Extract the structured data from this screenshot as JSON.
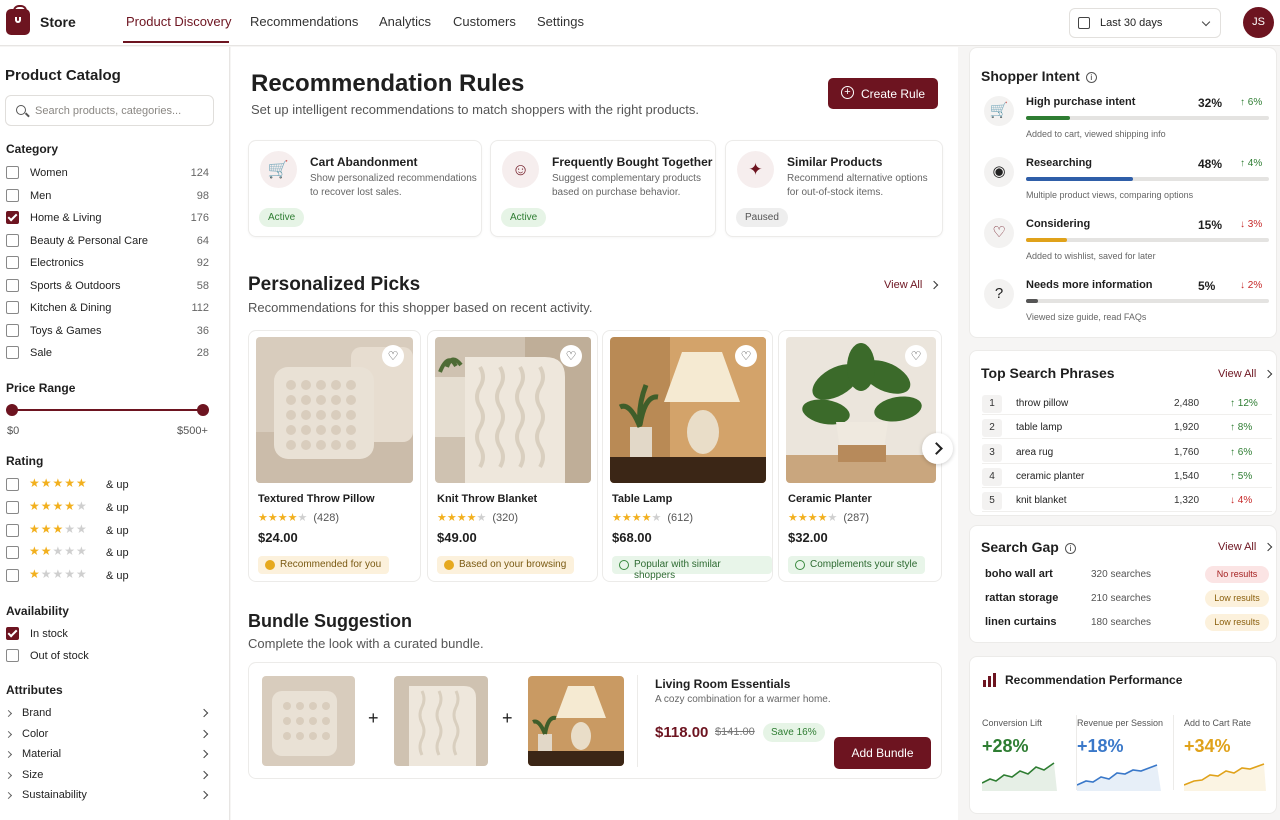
{
  "topbar": {
    "brand": "Store",
    "nav": [
      "Product Discovery",
      "Recommendations",
      "Analytics",
      "Customers",
      "Settings"
    ],
    "date_range": "Last 30 days",
    "avatar_initials": "JS"
  },
  "sidebar": {
    "title": "Product Catalog",
    "search_placeholder": "Search products, categories...",
    "category_heading": "Category",
    "categories": [
      {
        "label": "Women",
        "count": "124",
        "checked": false
      },
      {
        "label": "Men",
        "count": "98",
        "checked": false
      },
      {
        "label": "Home & Living",
        "count": "176",
        "checked": true
      },
      {
        "label": "Beauty & Personal Care",
        "count": "64",
        "checked": false
      },
      {
        "label": "Electronics",
        "count": "92",
        "checked": false
      },
      {
        "label": "Sports & Outdoors",
        "count": "58",
        "checked": false
      },
      {
        "label": "Kitchen & Dining",
        "count": "112",
        "checked": false
      },
      {
        "label": "Toys & Games",
        "count": "36",
        "checked": false
      },
      {
        "label": "Sale",
        "count": "28",
        "checked": false
      }
    ],
    "price_heading": "Price Range",
    "price_min": "$0",
    "price_max": "$500+",
    "rating_heading": "Rating",
    "rating_suffix": "& up",
    "ratings": [
      5,
      4,
      3,
      2,
      1
    ],
    "availability_heading": "Availability",
    "availability": [
      {
        "label": "In stock",
        "checked": true
      },
      {
        "label": "Out of stock",
        "checked": false
      }
    ],
    "attributes_heading": "Attributes",
    "attributes": [
      "Brand",
      "Color",
      "Material",
      "Size",
      "Sustainability"
    ]
  },
  "main": {
    "title": "Recommendation Rules",
    "subtitle": "Set up intelligent recommendations to match shoppers with the right products.",
    "create_button": "Create Rule",
    "rules": [
      {
        "title": "Cart Abandonment",
        "desc": "Show personalized recommendations to recover lost sales.",
        "status": "Active",
        "icon": "cart-icon"
      },
      {
        "title": "Frequently Bought Together",
        "desc": "Suggest complementary products based on purchase behavior.",
        "status": "Active",
        "icon": "people-icon"
      },
      {
        "title": "Similar Products",
        "desc": "Recommend alternative options for out-of-stock items.",
        "status": "Paused",
        "icon": "sparkle-icon"
      }
    ],
    "picks_title": "Personalized Picks",
    "picks_subtitle": "Recommendations for this shopper based on recent activity.",
    "view_all": "View All",
    "products": [
      {
        "name": "Textured Throw Pillow",
        "rating": 4.5,
        "reviews": "(428)",
        "price": "$24.00",
        "tag": "Recommended for you",
        "tag_style": "yellow"
      },
      {
        "name": "Knit Throw Blanket",
        "rating": 4.5,
        "reviews": "(320)",
        "price": "$49.00",
        "tag": "Based on your browsing",
        "tag_style": "yellow"
      },
      {
        "name": "Table Lamp",
        "rating": 4.5,
        "reviews": "(612)",
        "price": "$68.00",
        "tag": "Popular with similar shoppers",
        "tag_style": "green"
      },
      {
        "name": "Ceramic Planter",
        "rating": 4.5,
        "reviews": "(287)",
        "price": "$32.00",
        "tag": "Complements your style",
        "tag_style": "green"
      }
    ],
    "bundle_title": "Bundle Suggestion",
    "bundle_subtitle": "Complete the look with a curated bundle.",
    "bundle": {
      "name": "Living Room Essentials",
      "desc": "A cozy combination for a warmer home.",
      "price": "$118.00",
      "old_price": "$141.00",
      "save": "Save 16%",
      "button": "Add Bundle"
    }
  },
  "intent": {
    "title": "Shopper Intent",
    "items": [
      {
        "label": "High purchase intent",
        "pct": "32%",
        "delta": "6%",
        "dir": "up",
        "sub": "Added to cart, viewed shipping info",
        "fill": 0.18,
        "color": "#2e7d32",
        "icon": "cart-icon"
      },
      {
        "label": "Researching",
        "pct": "48%",
        "delta": "4%",
        "dir": "up",
        "sub": "Multiple product views, comparing options",
        "fill": 0.44,
        "color": "#2f5ea8",
        "icon": "eye-icon"
      },
      {
        "label": "Considering",
        "pct": "15%",
        "delta": "3%",
        "dir": "down",
        "sub": "Added to wishlist, saved for later",
        "fill": 0.17,
        "color": "#e0a21a",
        "icon": "heart-icon"
      },
      {
        "label": "Needs more information",
        "pct": "5%",
        "delta": "2%",
        "dir": "down",
        "sub": "Viewed size guide, read FAQs",
        "fill": 0.05,
        "color": "#555555",
        "icon": "question-icon"
      }
    ]
  },
  "searches": {
    "title": "Top Search Phrases",
    "view_all": "View All",
    "rows": [
      {
        "rank": "1",
        "phrase": "throw pillow",
        "count": "2,480",
        "delta": "12%",
        "dir": "up"
      },
      {
        "rank": "2",
        "phrase": "table lamp",
        "count": "1,920",
        "delta": "8%",
        "dir": "up"
      },
      {
        "rank": "3",
        "phrase": "area rug",
        "count": "1,760",
        "delta": "6%",
        "dir": "up"
      },
      {
        "rank": "4",
        "phrase": "ceramic planter",
        "count": "1,540",
        "delta": "5%",
        "dir": "up"
      },
      {
        "rank": "5",
        "phrase": "knit blanket",
        "count": "1,320",
        "delta": "4%",
        "dir": "down"
      }
    ]
  },
  "gap": {
    "title": "Search Gap",
    "view_all": "View All",
    "rows": [
      {
        "query": "boho wall art",
        "searches": "320 searches",
        "status": "No results",
        "style": "red"
      },
      {
        "query": "rattan storage",
        "searches": "210 searches",
        "status": "Low results",
        "style": "orange"
      },
      {
        "query": "linen curtains",
        "searches": "180 searches",
        "status": "Low results",
        "style": "orange"
      }
    ]
  },
  "performance": {
    "title": "Recommendation Performance",
    "metrics": [
      {
        "label": "Conversion Lift",
        "value": "+28%",
        "color": "#2e7d32"
      },
      {
        "label": "Revenue per Session",
        "value": "+18%",
        "color": "#3a78c9"
      },
      {
        "label": "Add to Cart Rate",
        "value": "+34%",
        "color": "#e0a21a"
      }
    ]
  }
}
